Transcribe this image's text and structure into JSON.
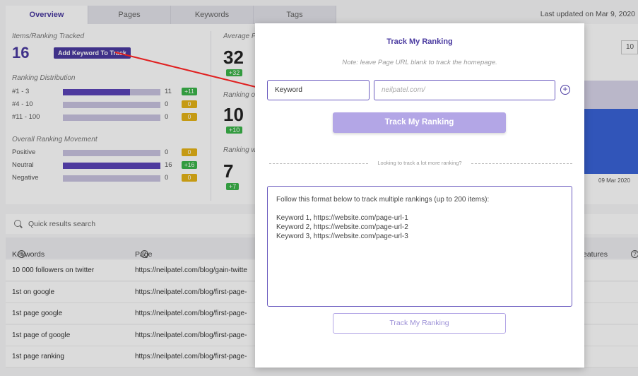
{
  "tabs": [
    "Overview",
    "Pages",
    "Keywords",
    "Tags"
  ],
  "last_updated": "Last updated on Mar 9, 2020",
  "tracked": {
    "label": "Items/Ranking Tracked",
    "value": "16",
    "add_button": "Add Keyword To Track"
  },
  "distribution": {
    "label": "Ranking Distribution",
    "rows": [
      {
        "label": "#1 - 3",
        "count": "11",
        "badge": "+11",
        "badge_color": "#3bb54a",
        "fill": 0.69
      },
      {
        "label": "#4 - 10",
        "count": "0",
        "badge": "0",
        "badge_color": "#e6b417",
        "fill": 0
      },
      {
        "label": "#11 - 100",
        "count": "0",
        "badge": "0",
        "badge_color": "#e6b417",
        "fill": 0
      }
    ]
  },
  "movement": {
    "label": "Overall Ranking Movement",
    "rows": [
      {
        "label": "Positive",
        "count": "0",
        "badge": "0",
        "badge_color": "#e6b417",
        "fill": 0
      },
      {
        "label": "Neutral",
        "count": "16",
        "badge": "+16",
        "badge_color": "#3bb54a",
        "fill": 1
      },
      {
        "label": "Negative",
        "count": "0",
        "badge": "0",
        "badge_color": "#e6b417",
        "fill": 0
      }
    ]
  },
  "middle": {
    "avg_label": "Average P",
    "avg_value": "32",
    "avg_badge": "+32",
    "rank_label": "Ranking o",
    "rank_value": "10",
    "rank_badge": "+10",
    "rankw_label": "Ranking w",
    "rankw_value": "7",
    "rankw_badge": "+7"
  },
  "right_panel": {
    "input_value": "10",
    "date": "09 Mar 2020"
  },
  "search": {
    "placeholder": "Quick results search"
  },
  "table": {
    "headers": {
      "keywords": "Keywords",
      "page": "Page",
      "features": "eatures"
    },
    "rows": [
      {
        "keyword": "10 000 followers on twitter",
        "page": "https://neilpatel.com/blog/gain-twitte"
      },
      {
        "keyword": "1st on google",
        "page": "https://neilpatel.com/blog/first-page-"
      },
      {
        "keyword": "1st page google",
        "page": "https://neilpatel.com/blog/first-page-"
      },
      {
        "keyword": "1st page of google",
        "page": "https://neilpatel.com/blog/first-page-"
      },
      {
        "keyword": "1st page ranking",
        "page": "https://neilpatel.com/blog/first-page-"
      }
    ]
  },
  "modal": {
    "title": "Track My Ranking",
    "note": "Note: leave Page URL blank to track the homepage.",
    "keyword_placeholder": "Keyword",
    "url_placeholder": "neilpatel.com/",
    "primary_button": "Track My Ranking",
    "divider_text": "Looking to track a lot more ranking?",
    "bulk_intro": "Follow this format below to track multiple rankings (up to 200 items):",
    "bulk_lines": [
      "Keyword 1, https://website.com/page-url-1",
      "Keyword 2, https://website.com/page-url-2",
      "Keyword 3, https://website.com/page-url-3"
    ],
    "secondary_button": "Track My Ranking"
  },
  "colors": {
    "accent": "#4a3aa0",
    "arrow": "#e02020",
    "button_light": "#b3a6e6"
  }
}
